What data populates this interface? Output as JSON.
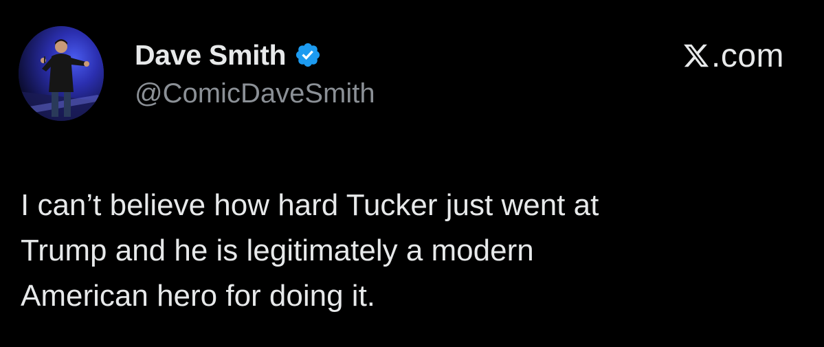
{
  "author": {
    "display_name": "Dave Smith",
    "handle": "@ComicDaveSmith",
    "verified": true,
    "verified_icon": "verified-badge-icon",
    "verified_color": "#1d9bf0"
  },
  "brand": {
    "logo_icon": "x-logo-icon",
    "site_text": ".com"
  },
  "tweet": {
    "lines": [
      "I can’t believe how hard Tucker just went at",
      "Trump and he is legitimately a modern",
      "American hero for doing it."
    ]
  },
  "colors": {
    "background": "#000000",
    "primary_text": "#e7e9ea",
    "secondary_text": "#8b9096"
  }
}
